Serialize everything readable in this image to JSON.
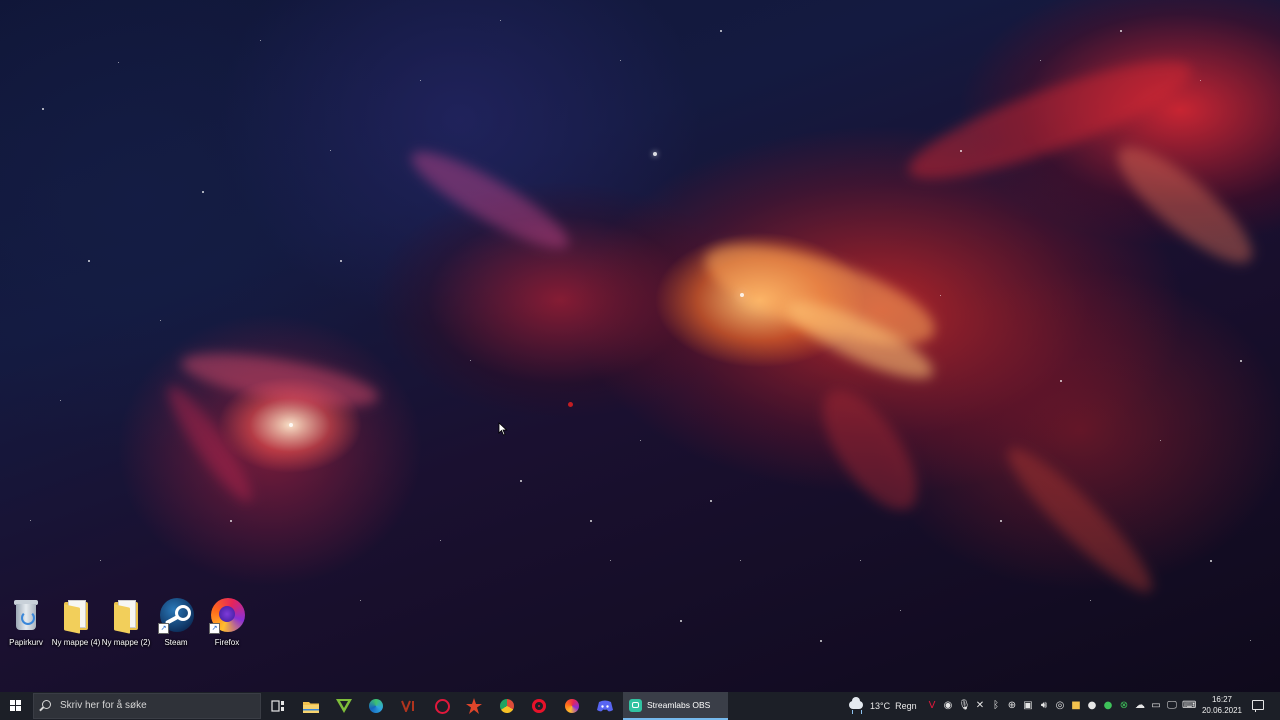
{
  "desktop": {
    "icons": [
      {
        "label": "Papirkurv",
        "icon": "recycle-bin-icon"
      },
      {
        "label": "Ny mappe (4)",
        "icon": "folder-icon"
      },
      {
        "label": "Ny mappe (2)",
        "icon": "folder-icon"
      },
      {
        "label": "Steam",
        "icon": "steam-icon"
      },
      {
        "label": "Firefox",
        "icon": "firefox-icon"
      }
    ]
  },
  "taskbar": {
    "search_placeholder": "Skriv her for å søke",
    "pinned_apps": [
      {
        "name": "task-view",
        "icon": "task-view-icon"
      },
      {
        "name": "file-explorer",
        "icon": "folder-icon",
        "color": "#f2c14e"
      },
      {
        "name": "vortex",
        "icon": "vortex-icon",
        "color": "#7fbf3a"
      },
      {
        "name": "edge",
        "icon": "edge-icon",
        "color": "#2fa6e0"
      },
      {
        "name": "vivaldi-v",
        "icon": "v-icon",
        "color": "#b0341e"
      },
      {
        "name": "opera-gx",
        "icon": "opera-gx-icon",
        "color": "#e0183c"
      },
      {
        "name": "app-star",
        "icon": "star-icon",
        "color": "#e0452a"
      },
      {
        "name": "chrome",
        "icon": "chrome-icon",
        "color": "#dd4b39"
      },
      {
        "name": "opera",
        "icon": "opera-icon",
        "color": "#e8122a"
      },
      {
        "name": "firefox",
        "icon": "firefox-icon",
        "color": "#ff6a1a"
      },
      {
        "name": "discord",
        "icon": "discord-icon",
        "color": "#5865f2"
      }
    ],
    "running_app": {
      "label": "Streamlabs OBS",
      "icon": "streamlabs-icon",
      "color": "#31c3a2"
    },
    "weather": {
      "temperature": "13°C",
      "condition": "Regn",
      "icon": "rain-cloud-icon"
    },
    "clock": {
      "time": "16:27",
      "date": "20.06.2021"
    },
    "accent_color": "#76b9ed"
  }
}
